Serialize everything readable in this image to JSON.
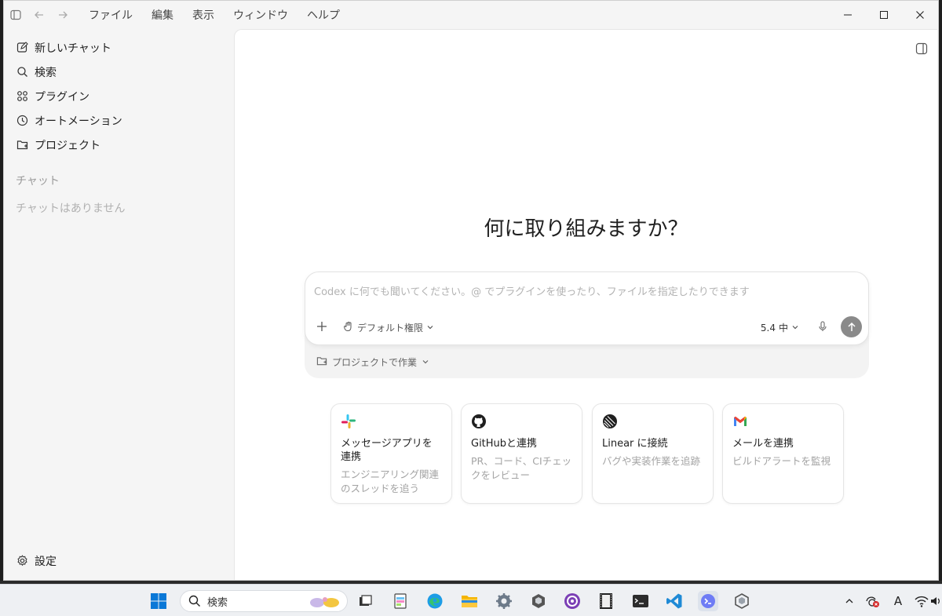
{
  "menu": [
    "ファイル",
    "編集",
    "表示",
    "ウィンドウ",
    "ヘルプ"
  ],
  "sidebar": {
    "items": [
      {
        "label": "新しいチャット",
        "icon": "new-chat-icon"
      },
      {
        "label": "検索",
        "icon": "search-icon"
      },
      {
        "label": "プラグイン",
        "icon": "plugins-icon"
      },
      {
        "label": "オートメーション",
        "icon": "clock-icon"
      },
      {
        "label": "プロジェクト",
        "icon": "folder-icon"
      }
    ],
    "chats_label": "チャット",
    "chats_empty": "チャットはありません",
    "settings_label": "設定"
  },
  "main": {
    "heading": "何に取り組みますか？",
    "composer": {
      "placeholder": "Codex に何でも聞いてください。@ でプラグインを使ったり、ファイルを指定したりできます",
      "permission": "デフォルト権限",
      "model": "5.4",
      "effort": "中"
    },
    "project_work": "プロジェクトで作業",
    "cards": [
      {
        "icon": "slack-icon",
        "title": "メッセージアプリを連携",
        "subtitle": "エンジニアリング関連のスレッドを追う"
      },
      {
        "icon": "github-icon",
        "title": "GitHubと連携",
        "subtitle": "PR、コード、CIチェックをレビュー"
      },
      {
        "icon": "linear-icon",
        "title": "Linear に接続",
        "subtitle": "バグや実装作業を追跡"
      },
      {
        "icon": "gmail-icon",
        "title": "メールを連携",
        "subtitle": "ビルドアラートを監視"
      }
    ]
  },
  "taskbar": {
    "search_label": "検索",
    "tray_ime": "A"
  },
  "colors": {
    "send_button": "#8a8a8a",
    "sidebar_bg": "#f5f5f5",
    "main_bg": "#ffffff"
  }
}
